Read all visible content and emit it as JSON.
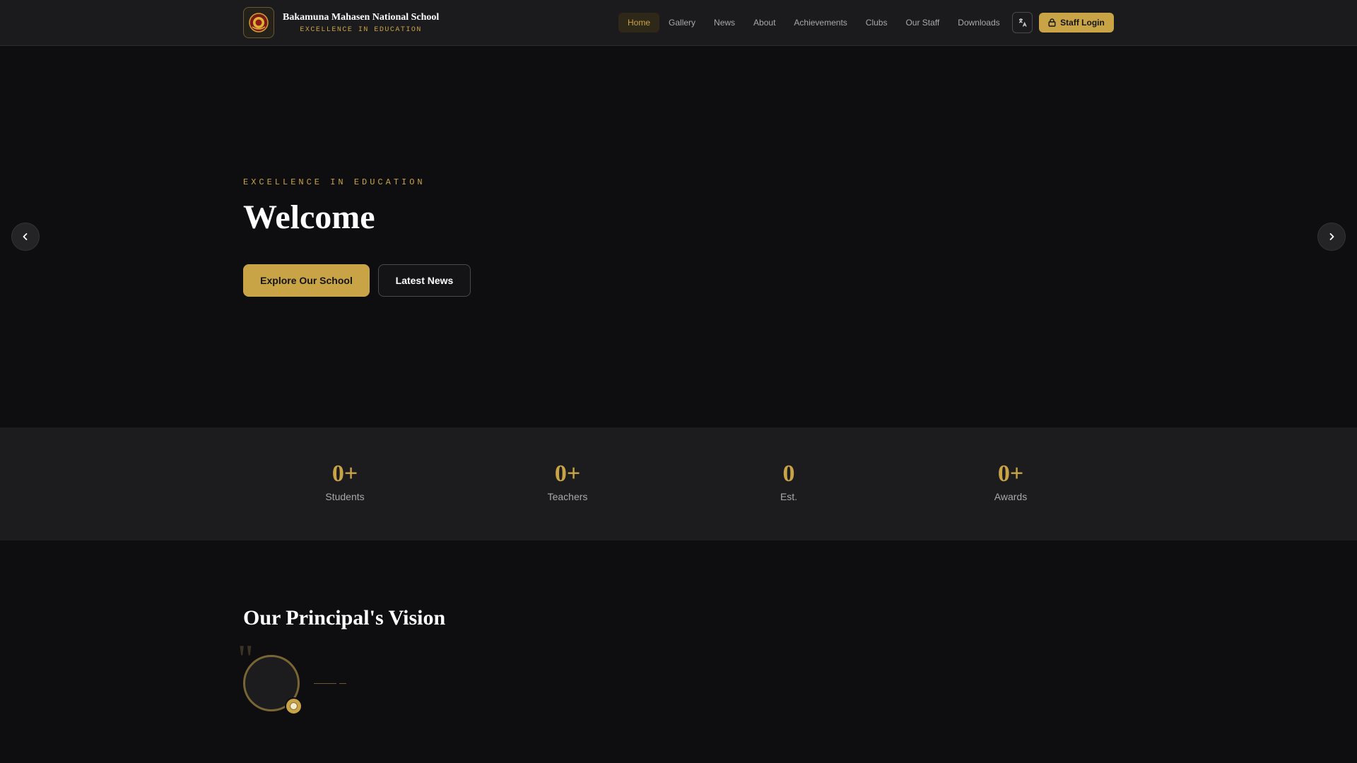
{
  "header": {
    "school_name": "Bakamuna Mahasen National School",
    "tagline": "EXCELLENCE IN EDUCATION",
    "nav": [
      {
        "label": "Home",
        "active": true
      },
      {
        "label": "Gallery"
      },
      {
        "label": "News"
      },
      {
        "label": "About"
      },
      {
        "label": "Achievements"
      },
      {
        "label": "Clubs"
      },
      {
        "label": "Our Staff"
      },
      {
        "label": "Downloads"
      }
    ],
    "language_icon": "translate-icon",
    "login_label": "Staff Login",
    "login_icon": "lock-icon"
  },
  "hero": {
    "eyebrow": "EXCELLENCE IN EDUCATION",
    "title": "Welcome",
    "primary_cta": "Explore Our School",
    "secondary_cta": "Latest News",
    "prev_icon": "chevron-left-icon",
    "next_icon": "chevron-right-icon"
  },
  "stats": [
    {
      "value": "0+",
      "label": "Students"
    },
    {
      "value": "0+",
      "label": "Teachers"
    },
    {
      "value": "0",
      "label": "Est."
    },
    {
      "value": "0+",
      "label": "Awards"
    }
  ],
  "principal": {
    "title": "Our Principal's Vision",
    "quote_mark": "\""
  },
  "colors": {
    "accent": "#c9a446",
    "background": "#0e0e10",
    "surface": "#1c1c1e"
  }
}
